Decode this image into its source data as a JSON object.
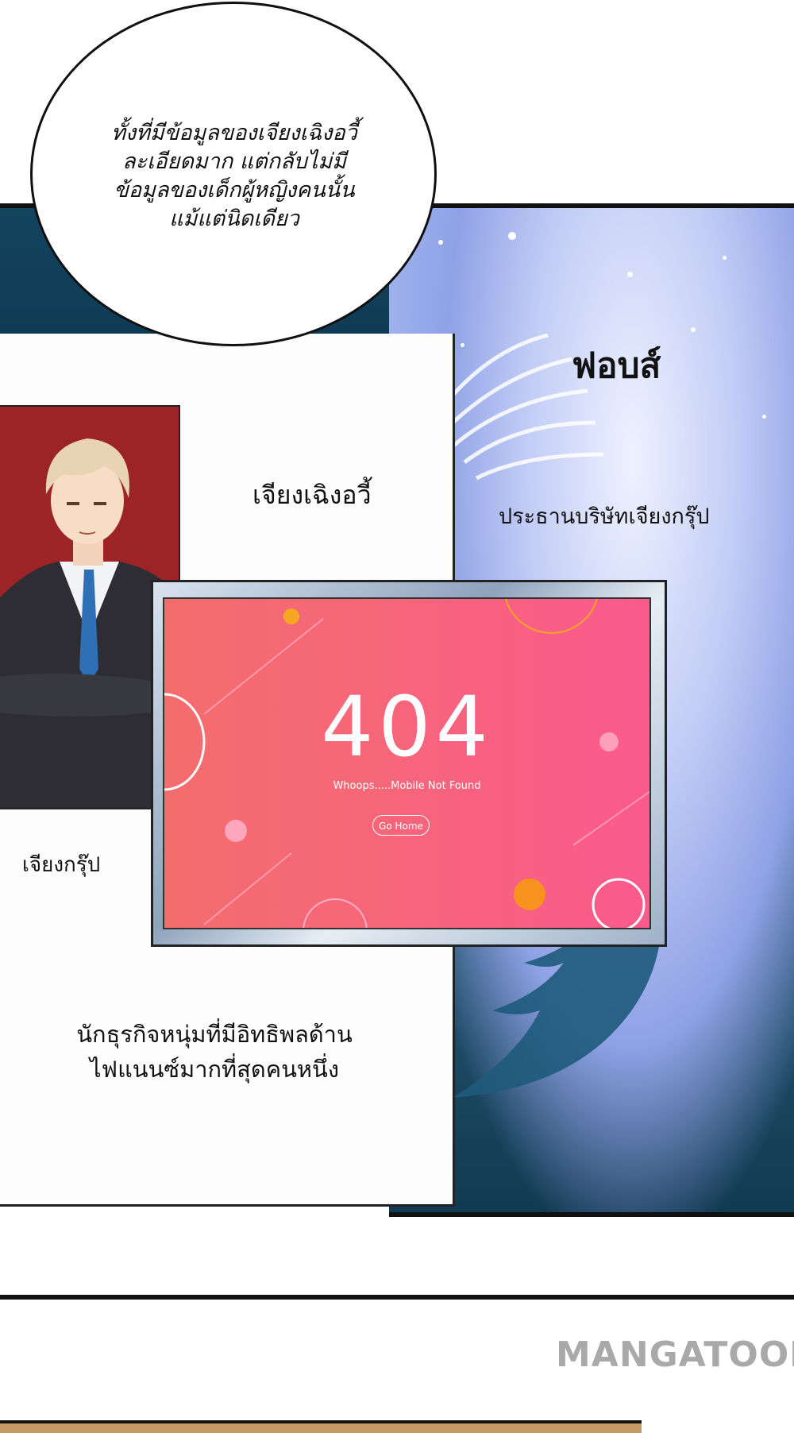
{
  "bubble": {
    "lines": [
      "ทั้งที่มีข้อมูลของเจียงเฉิงอวี้",
      "ละเอียดมาก แต่กลับไม่มี",
      "ข้อมูลของเด็กผู้หญิงคนนั้น",
      "แม้แต่นิดเดียว"
    ]
  },
  "forbes": "ฟอบส์",
  "forbes_caption": "ประธานบริษัทเจียงกรุ๊ป",
  "name": "เจียงเฉิงอวี้",
  "company": "เจียงกรุ๊ป",
  "description": [
    "นักธุรกิจหนุ่มที่มีอิทธิพลด้าน",
    "ไฟแนนซ์มากที่สุดคนหนึ่ง"
  ],
  "screen": {
    "code": "404",
    "message": "Whoops.....Mobile Not Found",
    "button": "Go Home"
  },
  "watermark": "MANGATOON",
  "colors": {
    "screen_left": "#f46d6d",
    "screen_right": "#fb5a8e",
    "card_red": "#9c2426"
  }
}
